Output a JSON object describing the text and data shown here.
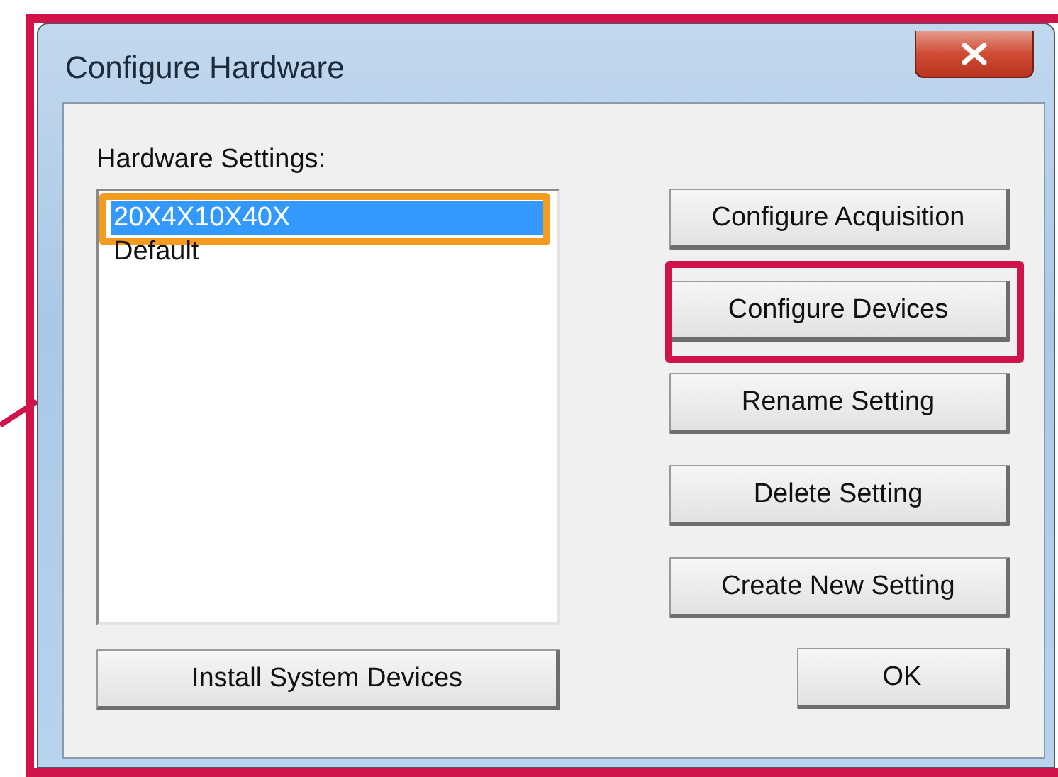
{
  "window": {
    "title": "Configure Hardware"
  },
  "settings_list": {
    "label": "Hardware Settings:",
    "items": [
      {
        "label": "20X4X10X40X",
        "selected": true,
        "highlighted": true
      },
      {
        "label": "Default",
        "selected": false,
        "highlighted": false
      }
    ]
  },
  "left_buttons": [
    {
      "label": "Install System Devices",
      "highlighted": false
    }
  ],
  "right_buttons": [
    {
      "label": "Configure Acquisition",
      "highlighted": false
    },
    {
      "label": "Configure Devices",
      "highlighted": true
    },
    {
      "label": "Rename Setting",
      "highlighted": false
    },
    {
      "label": "Delete Setting",
      "highlighted": false
    },
    {
      "label": "Create New Setting",
      "highlighted": false
    }
  ],
  "ok_button": {
    "label": "OK",
    "highlighted": false
  }
}
